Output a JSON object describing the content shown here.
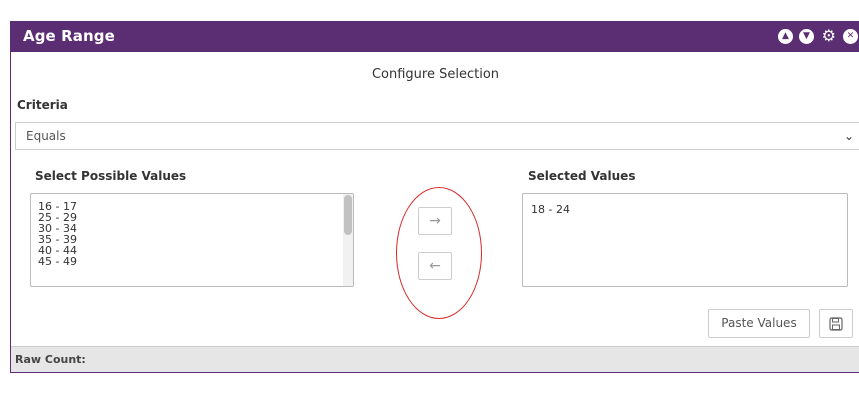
{
  "window": {
    "title": "Age Range",
    "icons": [
      "chevron-up-icon",
      "chevron-down-icon",
      "gear-icon",
      "close-icon"
    ]
  },
  "configure_heading": "Configure Selection",
  "criteria": {
    "label": "Criteria",
    "selected": "Equals"
  },
  "possible_values": {
    "label": "Select Possible Values",
    "items": [
      "16 - 17",
      "25 - 29",
      "30 - 34",
      "35 - 39",
      "40 - 44",
      "45 - 49"
    ]
  },
  "selected_values": {
    "label": "Selected Values",
    "items": [
      "18 - 24"
    ]
  },
  "buttons": {
    "paste_values": "Paste Values"
  },
  "footer": {
    "raw_count_label": "Raw Count:"
  },
  "colors": {
    "titlebar": "#5b2d73",
    "annotation": "#d62a2a"
  }
}
